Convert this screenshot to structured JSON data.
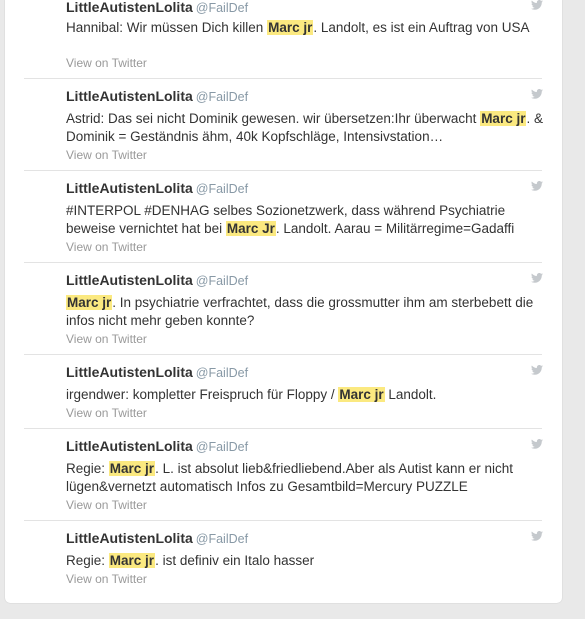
{
  "tweets": [
    {
      "author": "LittleAutistenLolita",
      "handle": "@FailDef",
      "parts": [
        {
          "text": "Hannibal: Wir müssen Dich killen "
        },
        {
          "text": "Marc jr",
          "hl": true
        },
        {
          "text": ". Landolt, es ist ein Auftrag von USA"
        }
      ],
      "view_label": "View on Twitter",
      "icon": "twitter-bird-icon"
    },
    {
      "author": "LittleAutistenLolita",
      "handle": "@FailDef",
      "parts": [
        {
          "text": "Astrid: Das sei nicht Dominik gewesen. wir übersetzen:Ihr überwacht "
        },
        {
          "text": "Marc jr",
          "hl": true
        },
        {
          "text": ". & Dominik = Geständnis ähm, 40k Kopfschläge, Intensivstation…"
        }
      ],
      "view_label": "View on Twitter",
      "icon": "twitter-bird-icon"
    },
    {
      "author": "LittleAutistenLolita",
      "handle": "@FailDef",
      "parts": [
        {
          "text": "#INTERPOL #DENHAG selbes Sozionetzwerk, dass während Psychiatrie beweise vernichtet hat bei "
        },
        {
          "text": "Marc Jr",
          "hl": true
        },
        {
          "text": ". Landolt. Aarau = Militärregime=Gadaffi"
        }
      ],
      "view_label": "View on Twitter",
      "icon": "twitter-bird-icon"
    },
    {
      "author": "LittleAutistenLolita",
      "handle": "@FailDef",
      "parts": [
        {
          "text": "Marc jr",
          "hl": true
        },
        {
          "text": ". In psychiatrie verfrachtet, dass die grossmutter ihm am sterbebett die infos nicht mehr geben konnte?"
        }
      ],
      "view_label": "View on Twitter",
      "icon": "twitter-bird-icon"
    },
    {
      "author": "LittleAutistenLolita",
      "handle": "@FailDef",
      "parts": [
        {
          "text": "irgendwer: kompletter Freispruch für Floppy / "
        },
        {
          "text": "Marc jr",
          "hl": true
        },
        {
          "text": " Landolt."
        }
      ],
      "view_label": "View on Twitter",
      "icon": "twitter-bird-icon"
    },
    {
      "author": "LittleAutistenLolita",
      "handle": "@FailDef",
      "parts": [
        {
          "text": "Regie: "
        },
        {
          "text": "Marc jr",
          "hl": true
        },
        {
          "text": ". L. ist absolut lieb&friedliebend.Aber als Autist kann er nicht lügen&vernetzt automatisch Infos zu Gesamtbild=Mercury PUZZLE"
        }
      ],
      "view_label": "View on Twitter",
      "icon": "twitter-bird-icon"
    },
    {
      "author": "LittleAutistenLolita",
      "handle": "@FailDef",
      "parts": [
        {
          "text": "Regie: "
        },
        {
          "text": "Marc jr",
          "hl": true
        },
        {
          "text": ". ist definiv ein Italo hasser"
        }
      ],
      "view_label": "View on Twitter",
      "icon": "twitter-bird-icon"
    }
  ],
  "colors": {
    "highlight": "#fbe980",
    "text": "#333333",
    "muted": "#999999",
    "handle": "#8899a6",
    "icon": "#c5c9cd",
    "background": "#e9e9e9"
  }
}
